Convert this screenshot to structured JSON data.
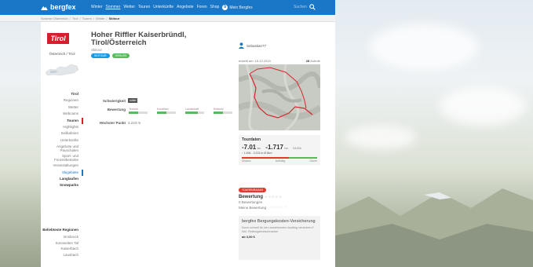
{
  "header": {
    "logo_text": "bergfex",
    "nav": [
      "Winter",
      "Sommer",
      "Wetter",
      "Touren",
      "Unterkünfte",
      "Angebote",
      "Foren",
      "Shop"
    ],
    "nav_active_index": 1,
    "my_bergfex": "Mein Bergfex",
    "search_placeholder": "Suchen"
  },
  "breadcrumb": [
    "Sommer Österreich",
    "Tirol",
    "Touren",
    "Winter",
    "Skitour"
  ],
  "sidebar": {
    "region_label": "Österreich / Tirol",
    "items": [
      {
        "label": "Tirol",
        "style": "bold"
      },
      {
        "label": "Regionen",
        "style": ""
      },
      {
        "label": "Wetter",
        "style": ""
      },
      {
        "label": "Webcams",
        "style": ""
      },
      {
        "label": "Touren",
        "style": "active"
      },
      {
        "label": "Highlights",
        "style": ""
      },
      {
        "label": "Seilbahnen",
        "style": ""
      },
      {
        "label": "Unterkünfte",
        "style": ""
      },
      {
        "label": "Angebote und Pauschalen",
        "style": "two"
      },
      {
        "label": "Sport- und Freizeitbetriebe",
        "style": "two"
      },
      {
        "label": "Veranstaltungen",
        "style": ""
      },
      {
        "label": "Skigebiete",
        "style": "blue"
      },
      {
        "label": "Langlaufen",
        "style": "bold"
      },
      {
        "label": "Snowparks",
        "style": "bold"
      }
    ],
    "popular_title": "Beliebteste Regionen",
    "popular": [
      "Innsbruck",
      "Sonnseiten Tal",
      "Kaiserbach",
      "Lausbach"
    ]
  },
  "tour": {
    "title_line1": "Hoher Riffler Kaiserbründl,",
    "title_line2": "Tirol/Österreich",
    "subtitle": "Skitour",
    "pills": [
      {
        "label": "SKITOUR",
        "color": "#1a9ae0"
      },
      {
        "label": "GENUSS",
        "color": "#5cb85c"
      }
    ],
    "difficulty_label": "Schwierigkeit",
    "difficulty_value": "mittel",
    "rating_label": "Bewertung",
    "rating_categories": [
      {
        "name": "Technik",
        "level": 3
      },
      {
        "name": "Kondition",
        "level": 3
      },
      {
        "name": "Landschaft",
        "level": 4
      },
      {
        "name": "Erlebnis",
        "level": 3
      }
    ],
    "height_label": "Höchster Punkt",
    "height_value": "3.223 m"
  },
  "right": {
    "author": "Sebastian77",
    "created": "erstellt am: 16.12.2019",
    "likes_count": "28",
    "likes_label": "Aufrufe",
    "stats_title": "Tourdaten",
    "distance": "-7.01",
    "distance_unit": "km",
    "ascent": "-1.717",
    "ascent_unit": "hm",
    "duration": "04:00h",
    "range_line": "↑ 1.506 - 3.223 m Ø 8km",
    "stat_labels": [
      "Distanz",
      "Aufstieg",
      "Dauer"
    ],
    "pill_label": "TOURENRADAR",
    "bewertung_title": "Bewertung",
    "bew_count": "0 Bewertungen",
    "my_rating": "Meine Bewertung",
    "insurance_title": "bergfex Bergungskosten-Versicherung",
    "insurance_text": "Noch schnell für den anstehenden Ausflug versichern? Inkl. Rettungshubschrauber",
    "insurance_price": "ab 3,90 €"
  }
}
